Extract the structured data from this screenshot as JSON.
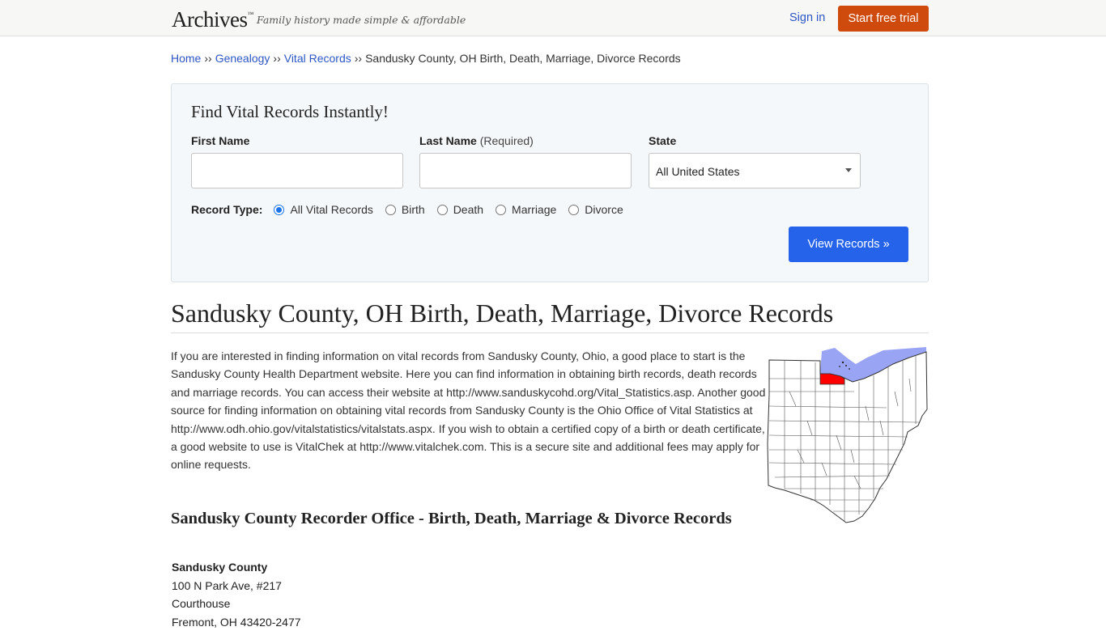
{
  "header": {
    "logo": "Archives",
    "logo_mark": "™",
    "tagline": "Family history made simple & affordable",
    "signin_label": "Sign in",
    "trial_label": "Start free trial"
  },
  "breadcrumb": {
    "items": [
      "Home",
      "Genealogy",
      "Vital Records"
    ],
    "separator": "››",
    "current": "Sandusky County, OH Birth, Death, Marriage, Divorce Records"
  },
  "search": {
    "title": "Find Vital Records Instantly!",
    "first_name_label": "First Name",
    "first_name_value": "",
    "last_name_label": "Last Name",
    "last_name_note": "(Required)",
    "last_name_value": "",
    "state_label": "State",
    "state_value": "All United States",
    "record_type_label": "Record Type:",
    "record_types": [
      "All Vital Records",
      "Birth",
      "Death",
      "Marriage",
      "Divorce"
    ],
    "record_type_selected": "All Vital Records",
    "submit_label": "View Records »"
  },
  "main": {
    "title": "Sandusky County, OH Birth, Death, Marriage, Divorce Records",
    "intro": "If you are interested in finding information on vital records from Sandusky County, Ohio, a good place to start is the Sandusky County Health Department website. Here you can find information in obtaining birth records, death records and marriage records. You can access their website at http://www.sanduskycohd.org/Vital_Statistics.asp. Another good source for finding information on obtaining vital records from Sandusky County is the Ohio Office of Vital Statistics at http://www.odh.ohio.gov/vitalstatistics/vitalstats.aspx. If you wish to obtain a certified copy of a birth or death certificate, a good website to use is VitalChek at http://www.vitalchek.com. This is a secure site and additional fees may apply for online requests.",
    "subheading": "Sandusky County Recorder Office - Birth, Death, Marriage & Divorce Records",
    "address": {
      "name": "Sandusky County",
      "line1": "100 N Park Ave, #217",
      "line2": "Courthouse",
      "line3": "Fremont, OH 43420-2477"
    }
  },
  "map": {
    "lake_color": "#9aa4f5",
    "highlight_color": "#ff0000"
  },
  "colors": {
    "link": "#2f56c5",
    "trial_button": "#cf4a0d",
    "view_button": "#2563eb",
    "search_bg": "#f5f8fa"
  }
}
